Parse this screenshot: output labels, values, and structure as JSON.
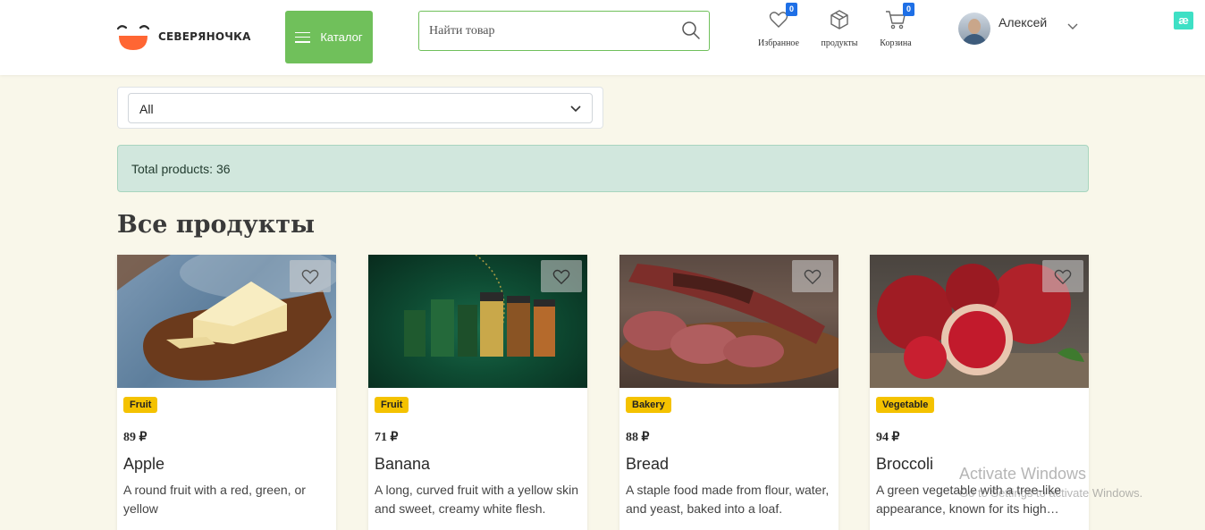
{
  "header": {
    "logo_text": "СЕВЕРЯНОЧКА",
    "catalog_label": "Каталог",
    "search_placeholder": "Найти товар",
    "nav": [
      {
        "label": "Избранное",
        "badge": "0",
        "icon": "heart-icon"
      },
      {
        "label": "продукты",
        "icon": "box-icon"
      },
      {
        "label": "Корзина",
        "badge": "0",
        "icon": "cart-icon"
      }
    ],
    "user_name": "Алексей",
    "extension_label": "æ"
  },
  "filter": {
    "selected": "All"
  },
  "total_text": "Total products: 36",
  "section_title": "Все продукты",
  "products": [
    {
      "category": "Fruit",
      "price": "89 ₽",
      "name": "Apple",
      "description": "A round fruit with a red, green, or yellow",
      "image": "butter"
    },
    {
      "category": "Fruit",
      "price": "71 ₽",
      "name": "Banana",
      "description": "A long, curved fruit with a yellow skin and sweet, creamy white flesh.",
      "image": "coffee"
    },
    {
      "category": "Bakery",
      "price": "88 ₽",
      "name": "Bread",
      "description": "A staple food made from flour, water, and yeast, baked into a loaf.",
      "image": "salami"
    },
    {
      "category": "Vegetable",
      "price": "94 ₽",
      "name": "Broccoli",
      "description": "A green vegetable with a tree-like appearance, known for its high…",
      "image": "pomegranate"
    }
  ],
  "watermark": {
    "line1": "Activate Windows",
    "line2": "Go to Settings to activate Windows."
  },
  "colors": {
    "accent_green": "#70c05b",
    "badge_blue": "#1e6fe6",
    "category_yellow": "#f4c200",
    "alert_bg": "#d1e7dd",
    "page_bg": "#f9f7ea"
  }
}
